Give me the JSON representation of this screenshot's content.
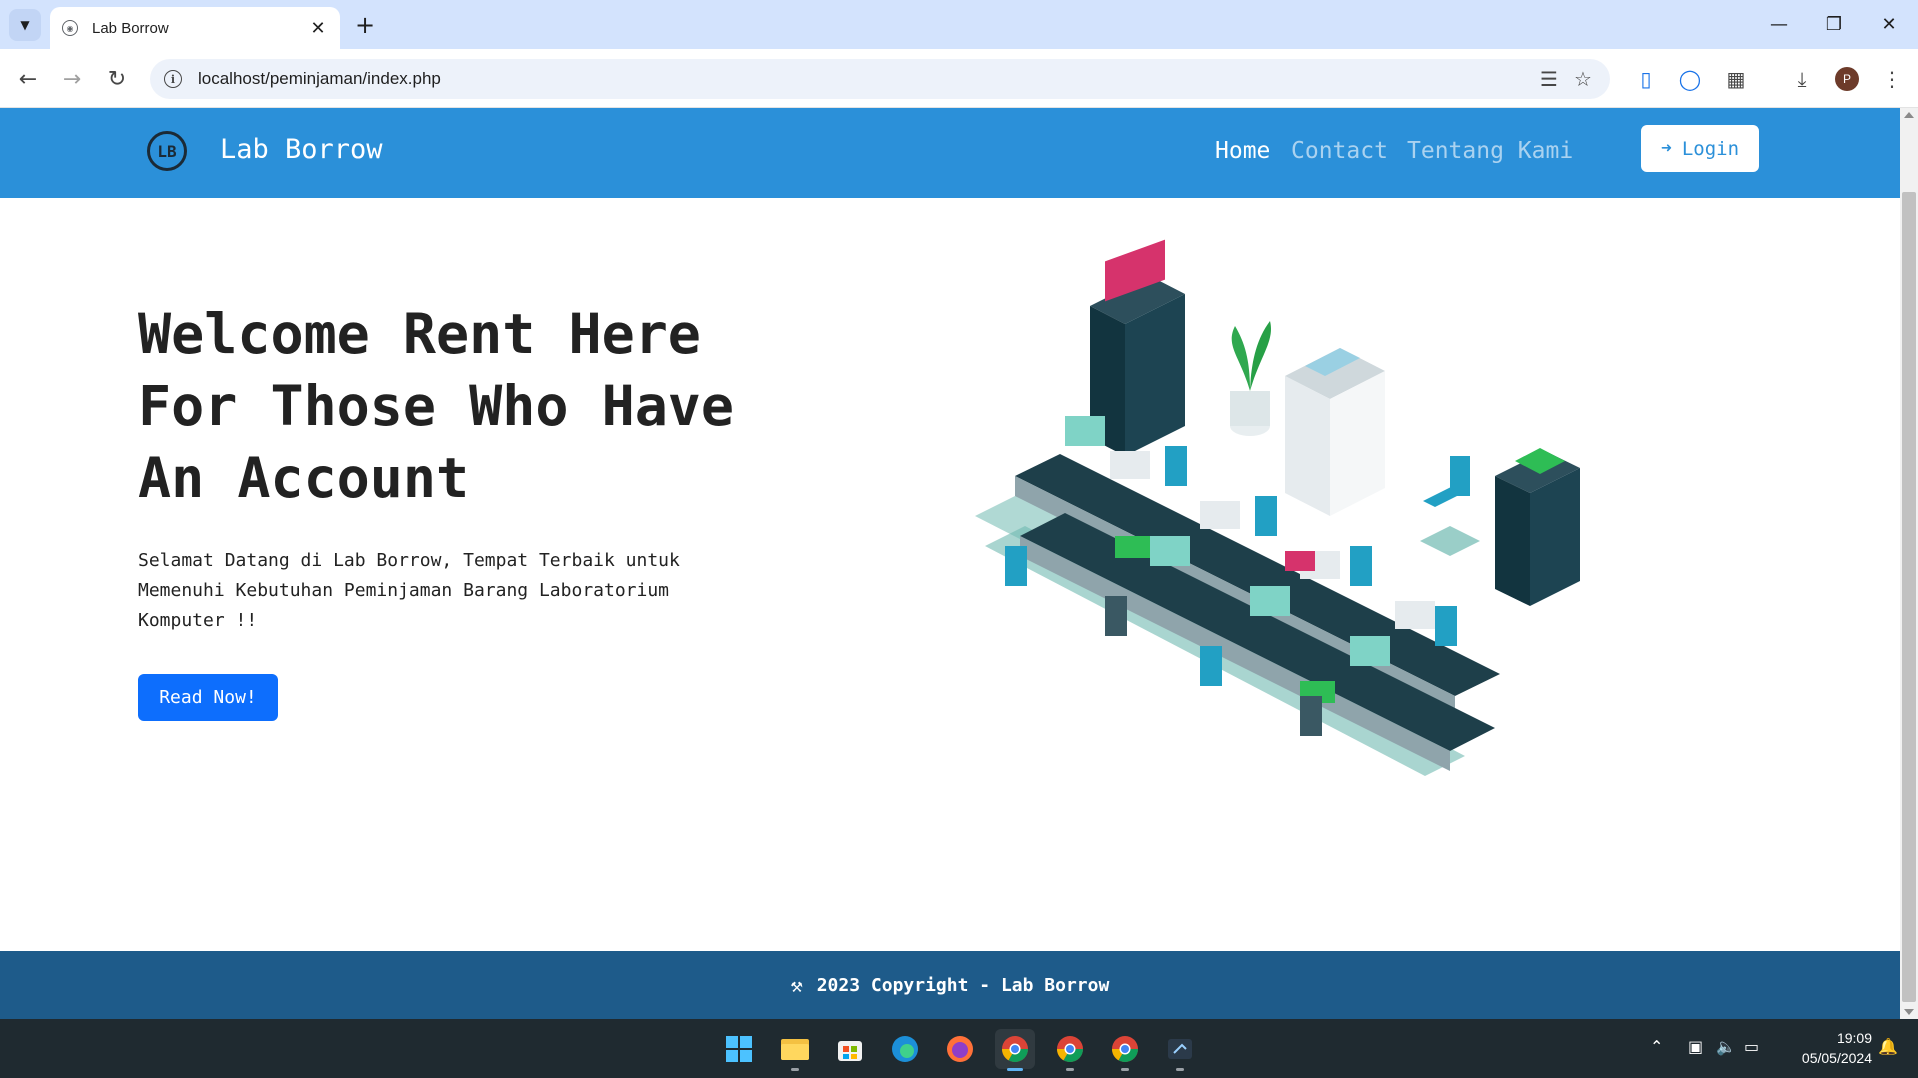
{
  "browser": {
    "tab_title": "Lab Borrow",
    "url": "localhost/peminjaman/index.php",
    "profile_initial": "P"
  },
  "site": {
    "brand_name": "Lab Borrow",
    "brand_logo_text": "LB",
    "nav": {
      "home": "Home",
      "contact": "Contact",
      "about": "Tentang Kami",
      "login": "Login"
    },
    "hero": {
      "title": "Welcome Rent Here For Those Who Have An Account",
      "text": "Selamat Datang di Lab Borrow, Tempat Terbaik untuk Memenuhi Kebutuhan Peminjaman Barang Laboratorium Komputer !!",
      "button": "Read Now!"
    },
    "footer": "2023 Copyright - Lab Borrow"
  },
  "taskbar": {
    "time": "19:09",
    "date": "05/05/2024"
  },
  "colors": {
    "nav_bg": "#2b90d9",
    "footer_bg": "#1e5b8a",
    "primary_button": "#0d6efd"
  }
}
